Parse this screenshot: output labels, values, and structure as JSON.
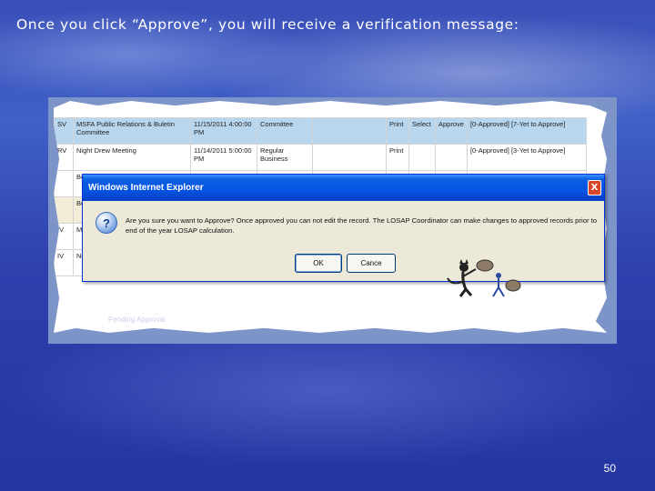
{
  "slide": {
    "title": "Once you click “Approve”, you will receive a verification message:",
    "page_number": "50"
  },
  "table": {
    "rows": [
      {
        "code": "SV",
        "event": "MSFA Public Relations & Buletin Committee",
        "date": "11/15/2011 4:00:00 PM",
        "type": "Committee",
        "print": "Print",
        "select": "Select",
        "approve": "Approve",
        "status": "[0-Approved] [7-Yet to Approve]",
        "style": "sel"
      },
      {
        "code": "RV",
        "event": "Night Drew Meeting",
        "date": "11/14/2011 5:00:00 PM",
        "type": "Regular Business",
        "print": "Print",
        "select": "",
        "approve": "",
        "status": "[0-Approved] [3-Yet to Approve]",
        "style": ""
      },
      {
        "code": "",
        "event": "Bo",
        "date": "",
        "type": "",
        "print": "",
        "select": "",
        "approve": "",
        "status": "",
        "style": ""
      },
      {
        "code": "",
        "event": "Bo",
        "date": "",
        "type": "",
        "print": "",
        "select": "",
        "approve": "",
        "status": "",
        "style": "tan"
      },
      {
        "code": "IV",
        "event": "Me",
        "date": "",
        "type": "",
        "print": "",
        "select": "",
        "approve": "",
        "status": "",
        "style": ""
      },
      {
        "code": "IV",
        "event": "Ne",
        "date": "",
        "type": "",
        "print": "",
        "select": "",
        "approve": "",
        "status": "",
        "style": ""
      }
    ],
    "footer_text": "Pending Approval"
  },
  "dialog": {
    "title": "Windows Internet Explorer",
    "close_label": "X",
    "message": "Are you sure you want to Approve? Once approved you can not edit the record. The LOSAP Coordinator can make changes to approved records prior to end of the year LOSAP calculation.",
    "ok_label": "OK",
    "cancel_label": "Cance",
    "icon_glyph": "?"
  },
  "colors": {
    "titlebar": "#0554e3",
    "selected_row": "#b8d6ee",
    "link": "#1b5fb0"
  }
}
